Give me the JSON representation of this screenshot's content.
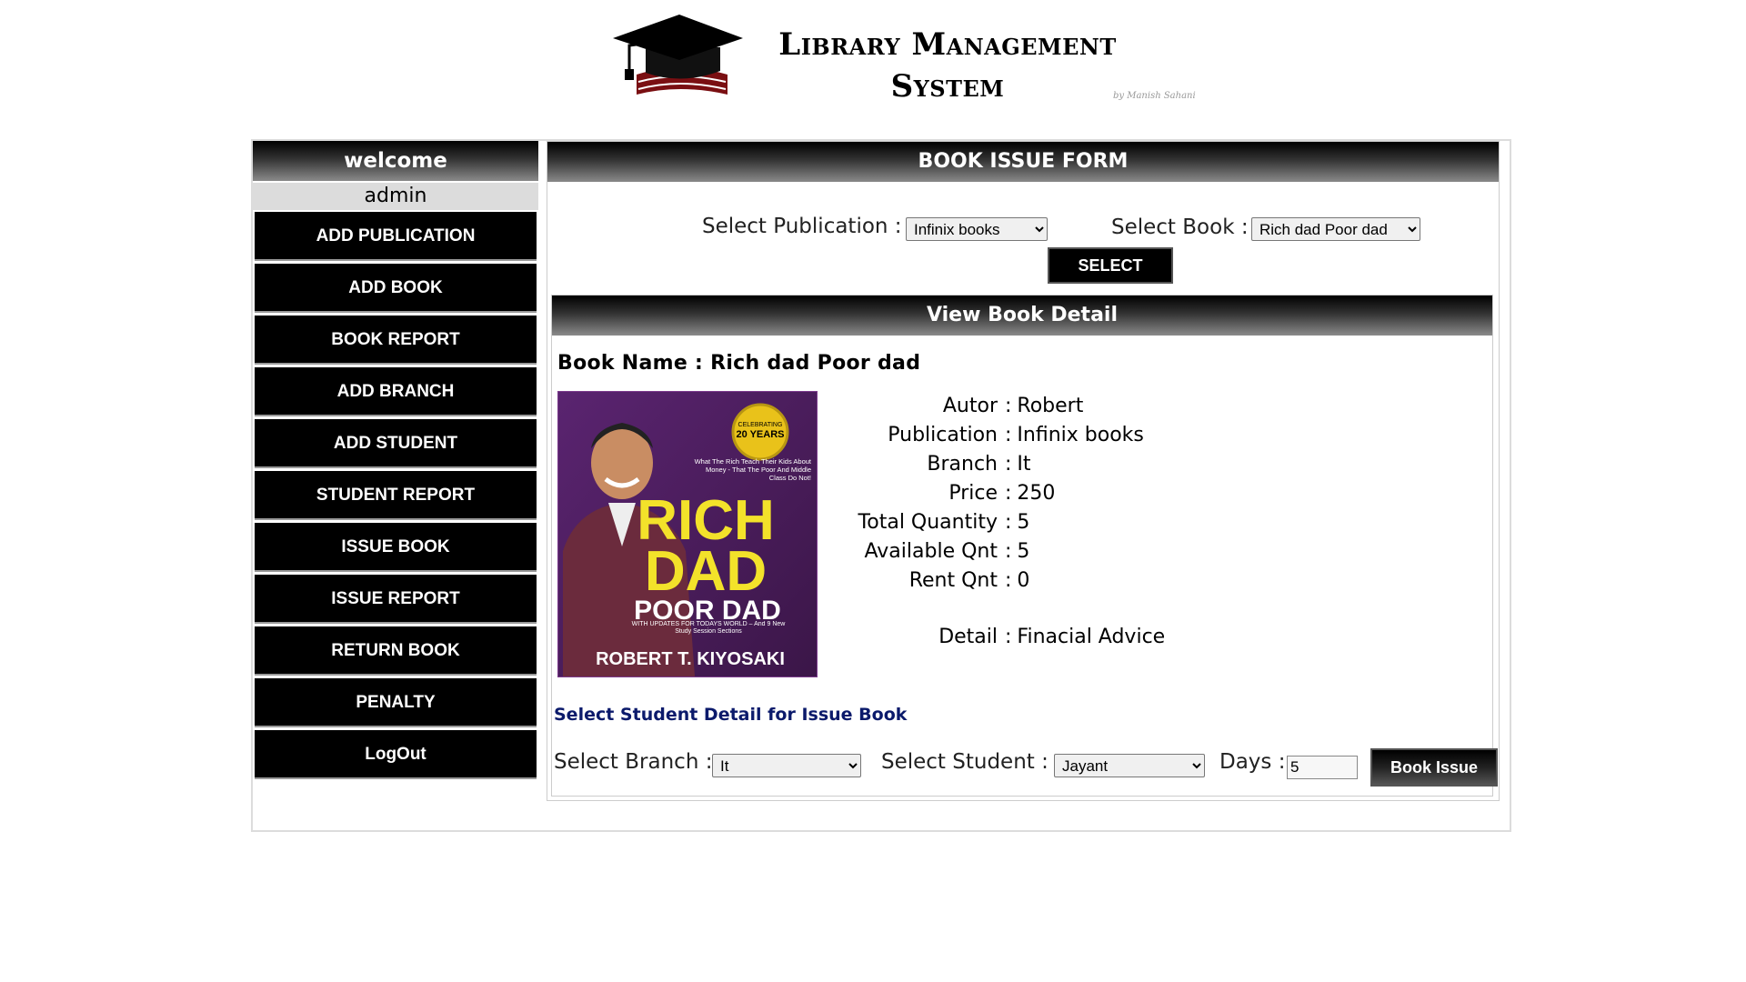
{
  "logo": {
    "title_line1": "Library Management",
    "title_line2": "System",
    "credit": "by Manish Sahani"
  },
  "sidebar": {
    "welcome": "welcome",
    "user": "admin",
    "items": [
      {
        "label": "ADD PUBLICATION"
      },
      {
        "label": "ADD BOOK"
      },
      {
        "label": "BOOK REPORT"
      },
      {
        "label": "ADD BRANCH"
      },
      {
        "label": "ADD STUDENT"
      },
      {
        "label": "STUDENT REPORT"
      },
      {
        "label": "ISSUE BOOK"
      },
      {
        "label": "ISSUE REPORT"
      },
      {
        "label": "RETURN BOOK"
      },
      {
        "label": "PENALTY"
      },
      {
        "label": "LogOut"
      }
    ]
  },
  "form": {
    "title": "BOOK ISSUE FORM",
    "publication_label": "Select Publication :",
    "publication_value": "Infinix books",
    "book_label": "Select Book :",
    "book_value": "Rich dad Poor dad",
    "select_button": "SELECT"
  },
  "detail": {
    "title": "View Book Detail",
    "book_name": "Book Name : Rich dad Poor dad",
    "cover": {
      "badge_line1": "CELEBRATING",
      "badge_line2": "20 YEARS",
      "tagline": "What The Rich Teach Their Kids About Money - That The Poor And Middle Class Do Not!",
      "title1": "RICH",
      "title2": "DAD",
      "title3": "POOR DAD",
      "subtitle": "WITH UPDATES FOR TODAYS WORLD – And 9 New Study Session Sections",
      "author": "ROBERT T. KIYOSAKI"
    },
    "fields": [
      {
        "key": "Autor",
        "value": "Robert"
      },
      {
        "key": "Publication",
        "value": "Infinix books"
      },
      {
        "key": "Branch",
        "value": "It"
      },
      {
        "key": "Price",
        "value": "250"
      },
      {
        "key": "Total Quantity",
        "value": "5"
      },
      {
        "key": "Available Qnt",
        "value": "5"
      },
      {
        "key": "Rent Qnt",
        "value": "0"
      }
    ],
    "detail_key": "Detail",
    "detail_value": "Finacial Advice"
  },
  "issue": {
    "section_title": "Select Student Detail for Issue Book",
    "branch_label": "Select Branch :",
    "branch_value": "It",
    "student_label": "Select Student :",
    "student_value": "Jayant",
    "days_label": "Days :",
    "days_value": "5",
    "issue_button": "Book Issue"
  }
}
